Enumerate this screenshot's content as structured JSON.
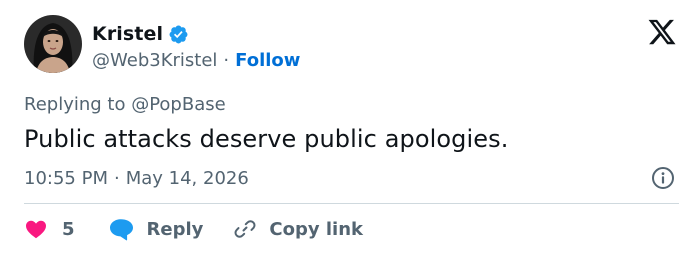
{
  "author": {
    "display_name": "Kristel",
    "handle": "@Web3Kristel",
    "separator": "·",
    "follow_label": "Follow",
    "avatar_icon": "profile-photo",
    "verified_icon": "verified-badge-icon"
  },
  "platform": {
    "logo_icon": "x-logo-icon"
  },
  "tweet": {
    "replying_to": "Replying to @PopBase",
    "text": "Public attacks deserve public apologies.",
    "time": "10:55 PM",
    "separator": "·",
    "date": "May 14, 2026",
    "info_icon": "info-icon"
  },
  "actions": {
    "like_count": "5",
    "reply_label": "Reply",
    "copy_label": "Copy link"
  },
  "colors": {
    "like": "#f91880",
    "accent": "#1d9bf0",
    "follow": "#006fd6",
    "secondary_text": "#536471",
    "primary_text": "#0f1419",
    "divider": "#cfd9de"
  }
}
